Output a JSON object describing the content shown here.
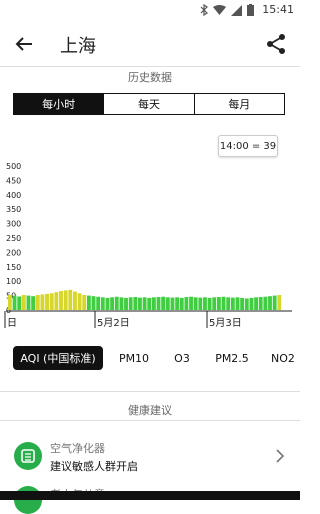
{
  "status": {
    "time": "15:41"
  },
  "header": {
    "title": "上海"
  },
  "history": {
    "label": "历史数据",
    "tabs": [
      "每小时",
      "每天",
      "每月"
    ],
    "active_tab": 0
  },
  "tooltip": "14:00 = 39",
  "chart_data": {
    "type": "bar",
    "y_ticks": [
      "500",
      "450",
      "400",
      "350",
      "300",
      "250",
      "200",
      "150",
      "100",
      "50",
      "0"
    ],
    "ylim": [
      0,
      500
    ],
    "x_labels": [
      "日",
      "5月2日",
      "5月3日"
    ],
    "colors": {
      "good": "#3fce3f",
      "moderate": "#d6d62b"
    },
    "values": [
      52,
      50,
      47,
      52,
      50,
      48,
      52,
      54,
      56,
      58,
      62,
      66,
      68,
      70,
      64,
      58,
      52,
      50,
      48,
      46,
      44,
      42,
      44,
      46,
      44,
      42,
      44,
      45,
      43,
      44,
      42,
      44,
      45,
      46,
      44,
      43,
      44,
      42,
      45,
      46,
      44,
      43,
      44,
      42,
      44,
      45,
      46,
      44,
      43,
      44,
      42,
      40,
      42,
      44,
      45,
      46,
      48,
      50,
      52
    ]
  },
  "pollutants": {
    "items": [
      "AQI (中国标准)",
      "PM10",
      "O3",
      "PM2.5",
      "NO2"
    ],
    "active": 0
  },
  "advice": {
    "label": "健康建议",
    "items": [
      {
        "title": "空气净化器",
        "subtitle": "建议敏感人群开启"
      },
      {
        "title": "老人与儿童"
      }
    ]
  }
}
